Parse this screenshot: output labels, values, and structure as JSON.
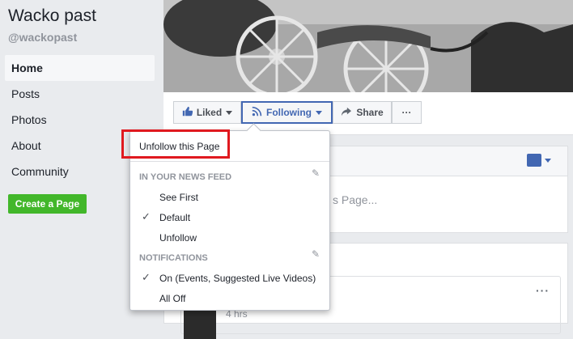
{
  "page": {
    "name": "Wacko past",
    "handle": "@wackopast"
  },
  "nav": {
    "items": [
      "Home",
      "Posts",
      "Photos",
      "About",
      "Community"
    ]
  },
  "create_page": "Create a Page",
  "actions": {
    "liked": "Liked",
    "following": "Following",
    "share": "Share",
    "more": "···"
  },
  "card1": {
    "placeholder": "s Page..."
  },
  "card2": {
    "more": "···",
    "time": "4 hrs"
  },
  "menu": {
    "unfollow_page": "Unfollow this Page",
    "news_feed_heading": "IN YOUR NEWS FEED",
    "news_feed_options": [
      "See First",
      "Default",
      "Unfollow"
    ],
    "notifications_heading": "NOTIFICATIONS",
    "notification_options": [
      "On (Events, Suggested Live Videos)",
      "All Off"
    ]
  },
  "colors": {
    "accent": "#4267b2",
    "create_green": "#42b72a",
    "highlight": "#e0191f"
  },
  "icons": [
    "thumbs-up-icon",
    "rss-icon",
    "share-arrow-icon",
    "pencil-icon",
    "check-icon"
  ]
}
